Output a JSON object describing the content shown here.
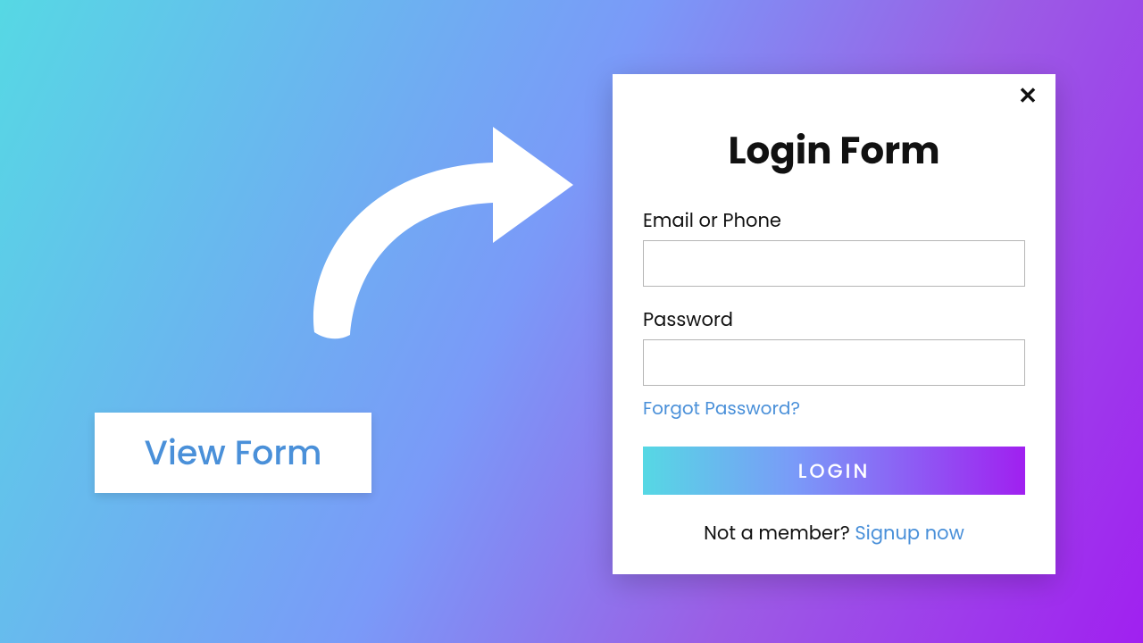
{
  "trigger": {
    "view_form_label": "View Form"
  },
  "modal": {
    "title": "Login Form",
    "email_label": "Email or Phone",
    "password_label": "Password",
    "forgot_link": "Forgot Password?",
    "login_button": "LOGIN",
    "signup_prefix": "Not a member? ",
    "signup_link": "Signup now",
    "close_icon": "✕"
  }
}
